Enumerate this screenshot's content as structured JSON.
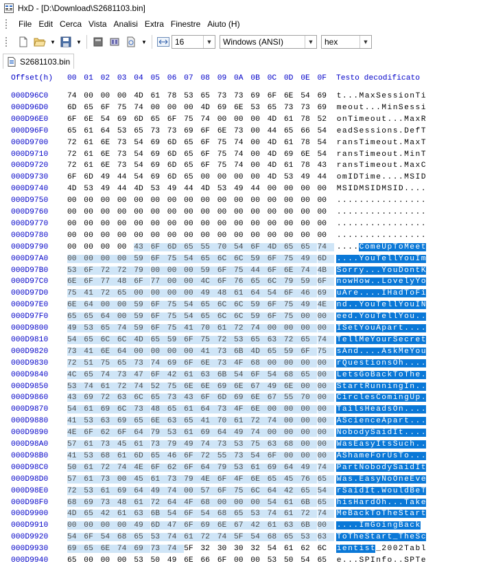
{
  "window": {
    "title": "HxD - [D:\\Download\\S2681103.bin]"
  },
  "menu": [
    "File",
    "Edit",
    "Cerca",
    "Vista",
    "Analisi",
    "Extra",
    "Finestre",
    "Aiuto (H)"
  ],
  "toolbar": {
    "bytes_per_row": "16",
    "charset": "Windows (ANSI)",
    "display_mode": "hex"
  },
  "tab": {
    "label": "S2681103.bin"
  },
  "header": {
    "offset_label": "Offset(h)",
    "columns": [
      "00",
      "01",
      "02",
      "03",
      "04",
      "05",
      "06",
      "07",
      "08",
      "09",
      "0A",
      "0B",
      "0C",
      "0D",
      "0E",
      "0F"
    ],
    "decoded_label": "Testo decodificato"
  },
  "rows": [
    {
      "offset": "000D96C0",
      "bytes": [
        "74",
        "00",
        "00",
        "00",
        "4D",
        "61",
        "78",
        "53",
        "65",
        "73",
        "73",
        "69",
        "6F",
        "6E",
        "54",
        "69"
      ],
      "text": "t...MaxSessionTi"
    },
    {
      "offset": "000D96D0",
      "bytes": [
        "6D",
        "65",
        "6F",
        "75",
        "74",
        "00",
        "00",
        "00",
        "4D",
        "69",
        "6E",
        "53",
        "65",
        "73",
        "73",
        "69"
      ],
      "text": "meout...MinSessi"
    },
    {
      "offset": "000D96E0",
      "bytes": [
        "6F",
        "6E",
        "54",
        "69",
        "6D",
        "65",
        "6F",
        "75",
        "74",
        "00",
        "00",
        "00",
        "4D",
        "61",
        "78",
        "52"
      ],
      "text": "onTimeout...MaxR"
    },
    {
      "offset": "000D96F0",
      "bytes": [
        "65",
        "61",
        "64",
        "53",
        "65",
        "73",
        "73",
        "69",
        "6F",
        "6E",
        "73",
        "00",
        "44",
        "65",
        "66",
        "54"
      ],
      "text": "eadSessions.DefT"
    },
    {
      "offset": "000D9700",
      "bytes": [
        "72",
        "61",
        "6E",
        "73",
        "54",
        "69",
        "6D",
        "65",
        "6F",
        "75",
        "74",
        "00",
        "4D",
        "61",
        "78",
        "54"
      ],
      "text": "ransTimeout.MaxT"
    },
    {
      "offset": "000D9710",
      "bytes": [
        "72",
        "61",
        "6E",
        "73",
        "54",
        "69",
        "6D",
        "65",
        "6F",
        "75",
        "74",
        "00",
        "4D",
        "69",
        "6E",
        "54"
      ],
      "text": "ransTimeout.MinT"
    },
    {
      "offset": "000D9720",
      "bytes": [
        "72",
        "61",
        "6E",
        "73",
        "54",
        "69",
        "6D",
        "65",
        "6F",
        "75",
        "74",
        "00",
        "4D",
        "61",
        "78",
        "43"
      ],
      "text": "ransTimeout.MaxC"
    },
    {
      "offset": "000D9730",
      "bytes": [
        "6F",
        "6D",
        "49",
        "44",
        "54",
        "69",
        "6D",
        "65",
        "00",
        "00",
        "00",
        "00",
        "4D",
        "53",
        "49",
        "44"
      ],
      "text": "omIDTime....MSID"
    },
    {
      "offset": "000D9740",
      "bytes": [
        "4D",
        "53",
        "49",
        "44",
        "4D",
        "53",
        "49",
        "44",
        "4D",
        "53",
        "49",
        "44",
        "00",
        "00",
        "00",
        "00"
      ],
      "text": "MSIDMSIDMSID...."
    },
    {
      "offset": "000D9750",
      "bytes": [
        "00",
        "00",
        "00",
        "00",
        "00",
        "00",
        "00",
        "00",
        "00",
        "00",
        "00",
        "00",
        "00",
        "00",
        "00",
        "00"
      ],
      "text": "................"
    },
    {
      "offset": "000D9760",
      "bytes": [
        "00",
        "00",
        "00",
        "00",
        "00",
        "00",
        "00",
        "00",
        "00",
        "00",
        "00",
        "00",
        "00",
        "00",
        "00",
        "00"
      ],
      "text": "................"
    },
    {
      "offset": "000D9770",
      "bytes": [
        "00",
        "00",
        "00",
        "00",
        "00",
        "00",
        "00",
        "00",
        "00",
        "00",
        "00",
        "00",
        "00",
        "00",
        "00",
        "00"
      ],
      "text": "................"
    },
    {
      "offset": "000D9780",
      "bytes": [
        "00",
        "00",
        "00",
        "00",
        "00",
        "00",
        "00",
        "00",
        "00",
        "00",
        "00",
        "00",
        "00",
        "00",
        "00",
        "00"
      ],
      "text": "................"
    },
    {
      "offset": "000D9790",
      "bytes": [
        "00",
        "00",
        "00",
        "00",
        "43",
        "6F",
        "6D",
        "65",
        "55",
        "70",
        "54",
        "6F",
        "4D",
        "65",
        "65",
        "74"
      ],
      "text": "....ComeUpToMeet"
    },
    {
      "offset": "000D97A0",
      "bytes": [
        "00",
        "00",
        "00",
        "00",
        "59",
        "6F",
        "75",
        "54",
        "65",
        "6C",
        "6C",
        "59",
        "6F",
        "75",
        "49",
        "6D"
      ],
      "text": "....YouTellYouIm"
    },
    {
      "offset": "000D97B0",
      "bytes": [
        "53",
        "6F",
        "72",
        "72",
        "79",
        "00",
        "00",
        "00",
        "59",
        "6F",
        "75",
        "44",
        "6F",
        "6E",
        "74",
        "4B"
      ],
      "text": "Sorry...YouDontK"
    },
    {
      "offset": "000D97C0",
      "bytes": [
        "6E",
        "6F",
        "77",
        "48",
        "6F",
        "77",
        "00",
        "00",
        "4C",
        "6F",
        "76",
        "65",
        "6C",
        "79",
        "59",
        "6F"
      ],
      "text": "nowHow..LovelyYo"
    },
    {
      "offset": "000D97D0",
      "bytes": [
        "75",
        "41",
        "72",
        "65",
        "00",
        "00",
        "00",
        "00",
        "49",
        "48",
        "61",
        "64",
        "54",
        "6F",
        "46",
        "69"
      ],
      "text": "uAre....IHadToFi"
    },
    {
      "offset": "000D97E0",
      "bytes": [
        "6E",
        "64",
        "00",
        "00",
        "59",
        "6F",
        "75",
        "54",
        "65",
        "6C",
        "6C",
        "59",
        "6F",
        "75",
        "49",
        "4E"
      ],
      "text": "nd..YouTellYouIN"
    },
    {
      "offset": "000D97F0",
      "bytes": [
        "65",
        "65",
        "64",
        "00",
        "59",
        "6F",
        "75",
        "54",
        "65",
        "6C",
        "6C",
        "59",
        "6F",
        "75",
        "00",
        "00"
      ],
      "text": "eed.YouTellYou.."
    },
    {
      "offset": "000D9800",
      "bytes": [
        "49",
        "53",
        "65",
        "74",
        "59",
        "6F",
        "75",
        "41",
        "70",
        "61",
        "72",
        "74",
        "00",
        "00",
        "00",
        "00"
      ],
      "text": "ISetYouApart...."
    },
    {
      "offset": "000D9810",
      "bytes": [
        "54",
        "65",
        "6C",
        "6C",
        "4D",
        "65",
        "59",
        "6F",
        "75",
        "72",
        "53",
        "65",
        "63",
        "72",
        "65",
        "74"
      ],
      "text": "TellMeYourSecret"
    },
    {
      "offset": "000D9820",
      "bytes": [
        "73",
        "41",
        "6E",
        "64",
        "00",
        "00",
        "00",
        "00",
        "41",
        "73",
        "6B",
        "4D",
        "65",
        "59",
        "6F",
        "75"
      ],
      "text": "sAnd....AskMeYou"
    },
    {
      "offset": "000D9830",
      "bytes": [
        "72",
        "51",
        "75",
        "65",
        "73",
        "74",
        "69",
        "6F",
        "6E",
        "73",
        "4F",
        "68",
        "00",
        "00",
        "00",
        "00"
      ],
      "text": "rQuestionsOh...."
    },
    {
      "offset": "000D9840",
      "bytes": [
        "4C",
        "65",
        "74",
        "73",
        "47",
        "6F",
        "42",
        "61",
        "63",
        "6B",
        "54",
        "6F",
        "54",
        "68",
        "65",
        "00"
      ],
      "text": "LetsGoBackToThe."
    },
    {
      "offset": "000D9850",
      "bytes": [
        "53",
        "74",
        "61",
        "72",
        "74",
        "52",
        "75",
        "6E",
        "6E",
        "69",
        "6E",
        "67",
        "49",
        "6E",
        "00",
        "00"
      ],
      "text": "StartRunningIn.."
    },
    {
      "offset": "000D9860",
      "bytes": [
        "43",
        "69",
        "72",
        "63",
        "6C",
        "65",
        "73",
        "43",
        "6F",
        "6D",
        "69",
        "6E",
        "67",
        "55",
        "70",
        "00"
      ],
      "text": "CirclesComingUp."
    },
    {
      "offset": "000D9870",
      "bytes": [
        "54",
        "61",
        "69",
        "6C",
        "73",
        "48",
        "65",
        "61",
        "64",
        "73",
        "4F",
        "6E",
        "00",
        "00",
        "00",
        "00"
      ],
      "text": "TailsHeadsOn...."
    },
    {
      "offset": "000D9880",
      "bytes": [
        "41",
        "53",
        "63",
        "69",
        "65",
        "6E",
        "63",
        "65",
        "41",
        "70",
        "61",
        "72",
        "74",
        "00",
        "00",
        "00"
      ],
      "text": "AScienceApart..."
    },
    {
      "offset": "000D9890",
      "bytes": [
        "4E",
        "6F",
        "62",
        "6F",
        "64",
        "79",
        "53",
        "61",
        "69",
        "64",
        "49",
        "74",
        "00",
        "00",
        "00",
        "00"
      ],
      "text": "NobodySaidIt...."
    },
    {
      "offset": "000D98A0",
      "bytes": [
        "57",
        "61",
        "73",
        "45",
        "61",
        "73",
        "79",
        "49",
        "74",
        "73",
        "53",
        "75",
        "63",
        "68",
        "00",
        "00"
      ],
      "text": "WasEasyItsSuch.."
    },
    {
      "offset": "000D98B0",
      "bytes": [
        "41",
        "53",
        "68",
        "61",
        "6D",
        "65",
        "46",
        "6F",
        "72",
        "55",
        "73",
        "54",
        "6F",
        "00",
        "00",
        "00"
      ],
      "text": "AShameForUsTo..."
    },
    {
      "offset": "000D98C0",
      "bytes": [
        "50",
        "61",
        "72",
        "74",
        "4E",
        "6F",
        "62",
        "6F",
        "64",
        "79",
        "53",
        "61",
        "69",
        "64",
        "49",
        "74"
      ],
      "text": "PartNobodySaidIt"
    },
    {
      "offset": "000D98D0",
      "bytes": [
        "57",
        "61",
        "73",
        "00",
        "45",
        "61",
        "73",
        "79",
        "4E",
        "6F",
        "4F",
        "6E",
        "65",
        "45",
        "76",
        "65"
      ],
      "text": "Was.EasyNoOneEve"
    },
    {
      "offset": "000D98E0",
      "bytes": [
        "72",
        "53",
        "61",
        "69",
        "64",
        "49",
        "74",
        "00",
        "57",
        "6F",
        "75",
        "6C",
        "64",
        "42",
        "65",
        "54"
      ],
      "text": "rSaidIt.WouldBeT"
    },
    {
      "offset": "000D98F0",
      "bytes": [
        "68",
        "69",
        "73",
        "48",
        "61",
        "72",
        "64",
        "4F",
        "68",
        "00",
        "00",
        "00",
        "54",
        "61",
        "6B",
        "65"
      ],
      "text": "hisHardOh...Take"
    },
    {
      "offset": "000D9900",
      "bytes": [
        "4D",
        "65",
        "42",
        "61",
        "63",
        "6B",
        "54",
        "6F",
        "54",
        "68",
        "65",
        "53",
        "74",
        "61",
        "72",
        "74"
      ],
      "text": "MeBackToTheStart"
    },
    {
      "offset": "000D9910",
      "bytes": [
        "00",
        "00",
        "00",
        "00",
        "49",
        "6D",
        "47",
        "6F",
        "69",
        "6E",
        "67",
        "42",
        "61",
        "63",
        "6B",
        "00"
      ],
      "text": "....ImGoingBack"
    },
    {
      "offset": "000D9920",
      "bytes": [
        "54",
        "6F",
        "54",
        "68",
        "65",
        "53",
        "74",
        "61",
        "72",
        "74",
        "5F",
        "54",
        "68",
        "65",
        "53",
        "63"
      ],
      "text": "ToTheStart_TheSc"
    },
    {
      "offset": "000D9930",
      "bytes": [
        "69",
        "65",
        "6E",
        "74",
        "69",
        "73",
        "74",
        "5F",
        "32",
        "30",
        "30",
        "32",
        "54",
        "61",
        "62",
        "6C"
      ],
      "text": "ientist_2002Tabl"
    },
    {
      "offset": "000D9940",
      "bytes": [
        "65",
        "00",
        "00",
        "00",
        "53",
        "50",
        "49",
        "6E",
        "66",
        "6F",
        "00",
        "00",
        "53",
        "50",
        "54",
        "65"
      ],
      "text": "e...SPInfo..SPTe"
    }
  ]
}
